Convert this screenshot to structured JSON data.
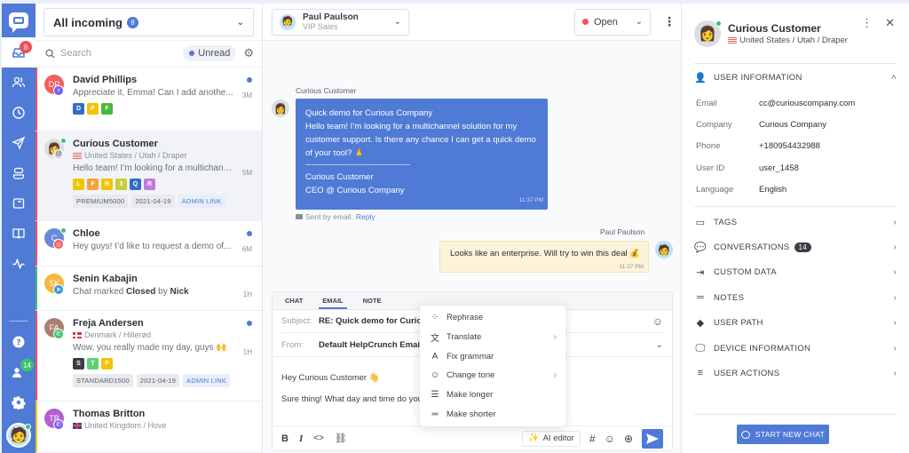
{
  "colors": {
    "brand": "#4f7ad6",
    "danger": "#f0505a",
    "online": "#3cc46b"
  },
  "rail": {
    "items": [
      {
        "icon": "inbox-icon",
        "badge": "8",
        "active": true
      },
      {
        "icon": "users-icon"
      },
      {
        "icon": "clock-icon"
      },
      {
        "icon": "send-icon"
      },
      {
        "icon": "bot-icon"
      },
      {
        "icon": "widget-icon"
      },
      {
        "icon": "book-icon"
      },
      {
        "icon": "activity-icon"
      }
    ],
    "bottom": [
      {
        "icon": "help-icon"
      },
      {
        "icon": "contacts-icon",
        "badge": "14"
      },
      {
        "icon": "settings-icon"
      }
    ]
  },
  "list": {
    "inbox_label": "All incoming",
    "inbox_count": "8",
    "search_placeholder": "Search",
    "unread_label": "Unread",
    "conversations": [
      {
        "name": "David Phillips",
        "initials": "DP",
        "avatar_color": "#f0605f",
        "channel": "messenger",
        "channel_color": "#7a5cf5",
        "stripe": "#f0505a",
        "message": "Appreciate it, Emma! Can I add anothe...",
        "time": "3M",
        "unread": true,
        "tags": [
          {
            "l": "D",
            "c": "#2f6fc2"
          },
          {
            "l": "P",
            "c": "#f2c500"
          },
          {
            "l": "F",
            "c": "#46b83a"
          }
        ]
      },
      {
        "name": "Curious Customer",
        "initials": "",
        "avatar_color": "#dcdde0",
        "channel": "email",
        "channel_color": "#dcdde0",
        "stripe": "#f0505a",
        "location": "United States / Utah / Draper",
        "flag": "us",
        "message": "Hello team! I’m looking for a multichann...",
        "time": "5M",
        "selected": true,
        "online": true,
        "tags": [
          {
            "l": "L",
            "c": "#f2c500"
          },
          {
            "l": "F",
            "c": "#f5a33a"
          },
          {
            "l": "R",
            "c": "#f2c500"
          },
          {
            "l": "3",
            "c": "#c5cf3a"
          },
          {
            "l": "Q",
            "c": "#2f6fc2"
          },
          {
            "l": "R",
            "c": "#c07be0"
          }
        ],
        "chips": [
          "PREMIUM5000",
          "2021-04-19"
        ],
        "link": "ADMIN LINK"
      },
      {
        "name": "Chloe",
        "initials": "C",
        "avatar_color": "#6a8ad8",
        "channel": "instagram",
        "channel_color": "#f05a5a",
        "stripe": "#f0505a",
        "message": "Hey guys! I’d like to request a demo of...",
        "time": "6M",
        "unread": true,
        "online": true
      },
      {
        "name": "Senin Kabajin",
        "initials": "SK",
        "avatar_color": "#f5b740",
        "channel": "telegram",
        "channel_color": "#3a9be0",
        "stripe": "#3cc46b",
        "message_pre": "Chat marked ",
        "message_b1": "Closed",
        "message_mid": " by ",
        "message_b2": "Nick",
        "time": "1H"
      },
      {
        "name": "Freja Andersen",
        "initials": "FA",
        "avatar_color": "#a88070",
        "channel": "whatsapp",
        "channel_color": "#3cc46b",
        "stripe": "#f0505a",
        "location": "Denmark / Hillerød",
        "flag": "dk",
        "message": "Wow, you really made my day, guys 🙌",
        "time": "1H",
        "unread": true,
        "tags": [
          {
            "l": "S",
            "c": "#3a3f47"
          },
          {
            "l": "T",
            "c": "#5ed07a"
          },
          {
            "l": "P",
            "c": "#f2c500"
          }
        ],
        "chips": [
          "STANDARD1500",
          "2021-04-19"
        ],
        "link": "ADMIN LINK"
      },
      {
        "name": "Thomas Britton",
        "initials": "TB",
        "avatar_color": "#b25ed0",
        "channel": "viber",
        "channel_color": "#7a5cf5",
        "stripe": "#f2c500",
        "location": "United Kingdom / Hove",
        "flag": "uk"
      }
    ]
  },
  "main": {
    "agent_name": "Paul Paulson",
    "agent_team": "VIP Sales",
    "status": "Open",
    "incoming": {
      "sender": "Curious Customer",
      "lines": [
        "Quick demo for Curious Company",
        "Hello team! I’m looking for a multichannel solution for my",
        "customer support. Is there any chance I can get a quick demo",
        "of your tool? 🙏",
        "-------------------------------------------",
        "Curious Customer",
        "CEO @ Curious Company"
      ],
      "time": "11:37 PM",
      "sent_by": "Sent by email.",
      "reply": "Reply"
    },
    "outgoing": {
      "sender": "Paul Paulson",
      "text": "Looks like an enterprise. Will try to win this deal 💰",
      "time": "11:37 PM"
    },
    "composer": {
      "tabs": [
        "CHAT",
        "EMAIL",
        "NOTE"
      ],
      "active_tab": "EMAIL",
      "subject_label": "Subject:",
      "subject_value": "RE: Quick demo for Curious",
      "from_label": "From:",
      "from_value": "Default HelpCrunch Email A",
      "body_line1": "Hey Curious Customer 👋",
      "body_line2": "Sure thing! What day and time do you",
      "ai_editor": "AI editor"
    },
    "ai_menu": [
      {
        "label": "Rephrase",
        "icon": "rephrase-icon",
        "glyph": "⁘",
        "sub": false
      },
      {
        "label": "Translate",
        "icon": "translate-icon",
        "glyph": "文",
        "sub": true
      },
      {
        "label": "Fix grammar",
        "icon": "grammar-icon",
        "glyph": "A",
        "sub": false
      },
      {
        "label": "Change tone",
        "icon": "tone-icon",
        "glyph": "☺",
        "sub": true
      },
      {
        "label": "Make longer",
        "icon": "longer-icon",
        "glyph": "☰",
        "sub": false
      },
      {
        "label": "Make shorter",
        "icon": "shorter-icon",
        "glyph": "═",
        "sub": false
      }
    ]
  },
  "side": {
    "name": "Curious Customer",
    "location": "United States / Utah / Draper",
    "user_info_label": "USER INFORMATION",
    "info": [
      {
        "k": "Email",
        "v": "cc@curiouscompany.com"
      },
      {
        "k": "Company",
        "v": "Curious Company"
      },
      {
        "k": "Phone",
        "v": "+180954432988"
      },
      {
        "k": "User ID",
        "v": "user_1458"
      },
      {
        "k": "Language",
        "v": "English"
      }
    ],
    "sections": [
      {
        "label": "TAGS",
        "icon": "tag-icon"
      },
      {
        "label": "CONVERSATIONS",
        "icon": "conversations-icon",
        "badge": "14"
      },
      {
        "label": "CUSTOM DATA",
        "icon": "custom-data-icon"
      },
      {
        "label": "NOTES",
        "icon": "notes-icon"
      },
      {
        "label": "USER PATH",
        "icon": "user-path-icon"
      },
      {
        "label": "DEVICE INFORMATION",
        "icon": "device-icon"
      },
      {
        "label": "USER ACTIONS",
        "icon": "user-actions-icon"
      }
    ],
    "start_chat": "START NEW CHAT"
  }
}
